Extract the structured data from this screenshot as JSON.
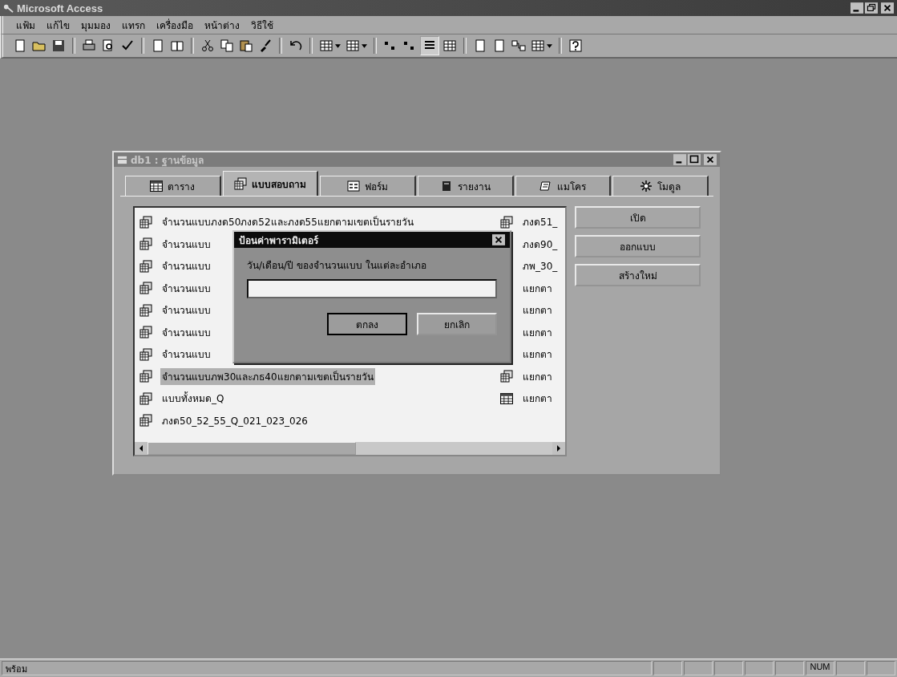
{
  "window": {
    "title": "Microsoft Access"
  },
  "menu": [
    "แฟ้ม",
    "แก้ไข",
    "มุมมอง",
    "แทรก",
    "เครื่องมือ",
    "หน้าต่าง",
    "วิธีใช้"
  ],
  "database_window": {
    "title": "db1 : ฐานข้อมูล",
    "tabs": [
      {
        "label": "ตาราง",
        "kind": "table",
        "selected": false
      },
      {
        "label": "แบบสอบถาม",
        "kind": "query",
        "selected": true
      },
      {
        "label": "ฟอร์ม",
        "kind": "form",
        "selected": false
      },
      {
        "label": "รายงาน",
        "kind": "report",
        "selected": false
      },
      {
        "label": "แมโคร",
        "kind": "macro",
        "selected": false
      },
      {
        "label": "โมดูล",
        "kind": "module",
        "selected": false
      }
    ],
    "objects_column_1": [
      {
        "name": "จำนวนแบบภงด50ภงด52และภงด55แยกตามเขตเป็นรายวัน",
        "kind": "query",
        "selected": false
      },
      {
        "name": "จำนวนแบบ",
        "kind": "query",
        "selected": false
      },
      {
        "name": "จำนวนแบบ",
        "kind": "query",
        "selected": false
      },
      {
        "name": "จำนวนแบบ",
        "kind": "query",
        "selected": false
      },
      {
        "name": "จำนวนแบบ",
        "kind": "query",
        "selected": false
      },
      {
        "name": "จำนวนแบบ",
        "kind": "query",
        "selected": false
      },
      {
        "name": "จำนวนแบบ",
        "kind": "query",
        "selected": false
      },
      {
        "name": "จำนวนแบบภพ30และภธ40แยกตามเขตเป็นรายวัน",
        "kind": "query",
        "selected": true
      },
      {
        "name": "แบบทั้งหมด_Q",
        "kind": "query",
        "selected": false
      },
      {
        "name": "ภงด50_52_55_Q_021_023_026",
        "kind": "query",
        "selected": false
      }
    ],
    "objects_column_2": [
      {
        "name": "ภงด51_",
        "kind": "query"
      },
      {
        "name": "ภงด90_",
        "kind": "covered"
      },
      {
        "name": "ภพ_30_",
        "kind": "covered"
      },
      {
        "name": "แยกตา",
        "kind": "covered"
      },
      {
        "name": "แยกตา",
        "kind": "covered"
      },
      {
        "name": "แยกตา",
        "kind": "covered"
      },
      {
        "name": "แยกตา",
        "kind": "covered"
      },
      {
        "name": "แยกตา",
        "kind": "query"
      },
      {
        "name": "แยกตา",
        "kind": "table"
      }
    ],
    "buttons": [
      "เปิด",
      "ออกแบบ",
      "สร้างใหม่"
    ]
  },
  "dialog": {
    "title": "ป้อนค่าพารามิเตอร์",
    "prompt": "วัน/เดือน/ปี ของจำนวนแบบ ในแต่ละอำเภอ",
    "buttons": [
      "ตกลง",
      "ยกเลิก"
    ]
  },
  "status_bar": {
    "text": "พร้อม",
    "indicators": [
      {
        "label": "NUM"
      }
    ]
  }
}
